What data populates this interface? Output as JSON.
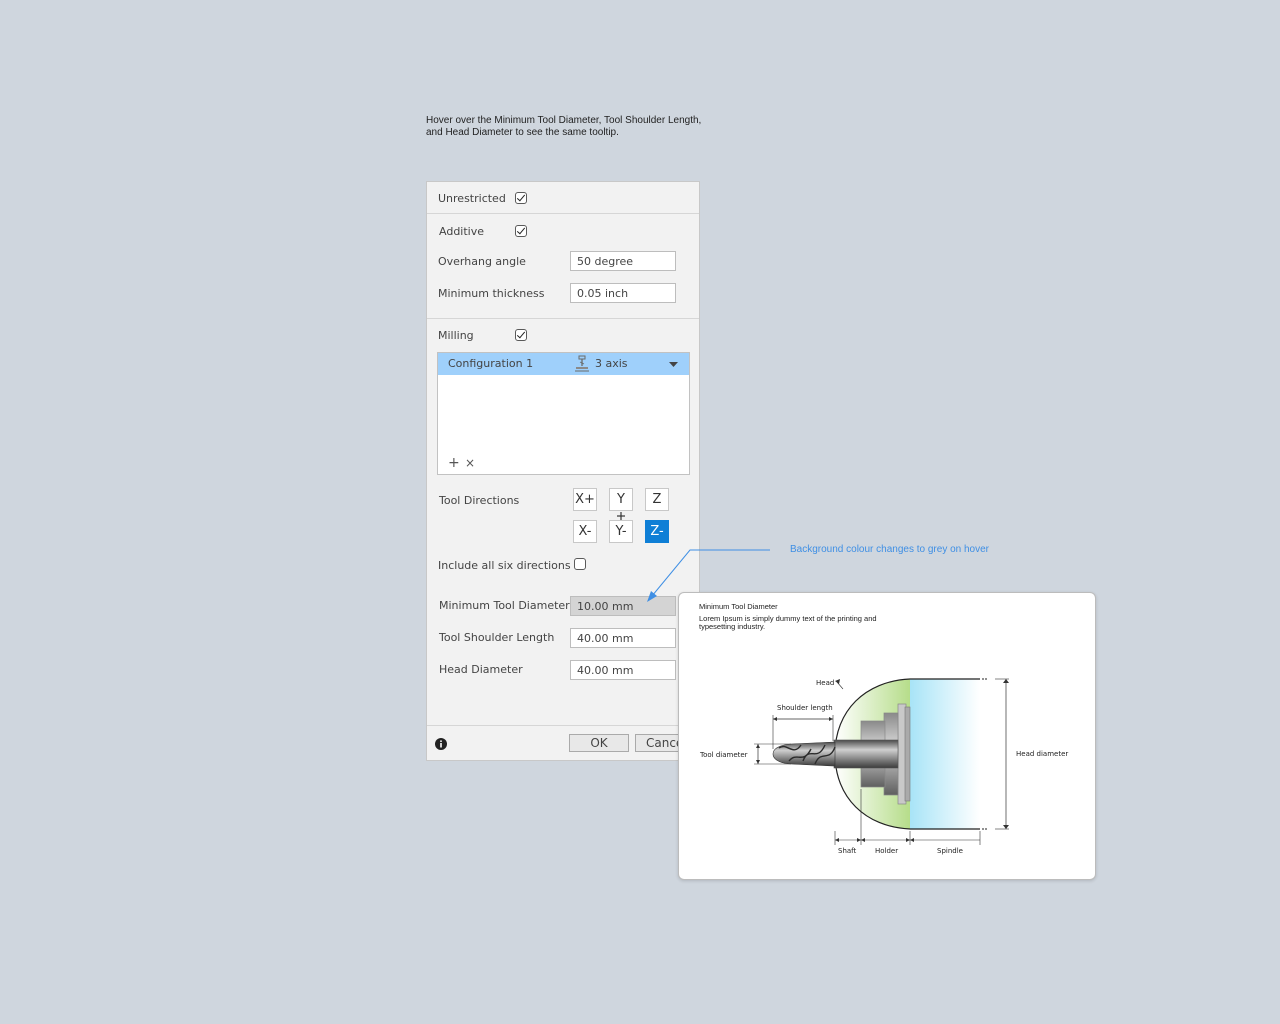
{
  "note": {
    "line1": "Hover over the Minimum Tool Diameter, Tool Shoulder Length,",
    "line2": "and Head Diameter to see the same tooltip."
  },
  "panel": {
    "unrestricted": {
      "label": "Unrestricted",
      "checked": true
    },
    "additive": {
      "label": "Additive",
      "checked": true
    },
    "overhang_angle": {
      "label": "Overhang angle",
      "value": "50 degree"
    },
    "minimum_thickness": {
      "label": "Minimum thickness",
      "value": "0.05 inch"
    },
    "milling": {
      "label": "Milling",
      "checked": true
    },
    "configuration": {
      "name": "Configuration 1",
      "axis": "3 axis",
      "axis_icon": "mill-axis-icon"
    },
    "config_actions": {
      "add": "+",
      "remove": "×"
    },
    "tool_directions": {
      "label": "Tool Directions",
      "buttons": [
        "X+",
        "Y",
        "Z",
        "X-",
        "Y-",
        "Z-"
      ],
      "selected": "Z-"
    },
    "include_six": {
      "label": "Include all six directions",
      "checked": false
    },
    "min_tool_diameter": {
      "label": "Minimum Tool Diameter",
      "value": "10.00 mm"
    },
    "tool_shoulder_length": {
      "label": "Tool Shoulder Length",
      "value": "40.00 mm"
    },
    "head_diameter": {
      "label": "Head Diameter",
      "value": "40.00 mm"
    },
    "footer": {
      "ok": "OK",
      "cancel": "Cance",
      "info_icon": "info-icon"
    }
  },
  "annotation": {
    "text": "Background colour changes to grey on hover"
  },
  "tooltip": {
    "title": "Minimum Tool Diameter",
    "body_line1": "Lorem Ipsum is simply dummy text of the printing and",
    "body_line2": "typesetting industry.",
    "diagram": {
      "head": "Head",
      "shoulder_length": "Shoulder length",
      "tool_diameter": "Tool diameter",
      "head_diameter": "Head diameter",
      "shaft": "Shaft",
      "holder": "Holder",
      "spindle": "Spindle"
    }
  },
  "colors": {
    "selection": "#9fd0fb",
    "selected_button": "#0f7fd6",
    "annotation": "#3f8fe4",
    "hover_field": "#d4d4d4"
  }
}
